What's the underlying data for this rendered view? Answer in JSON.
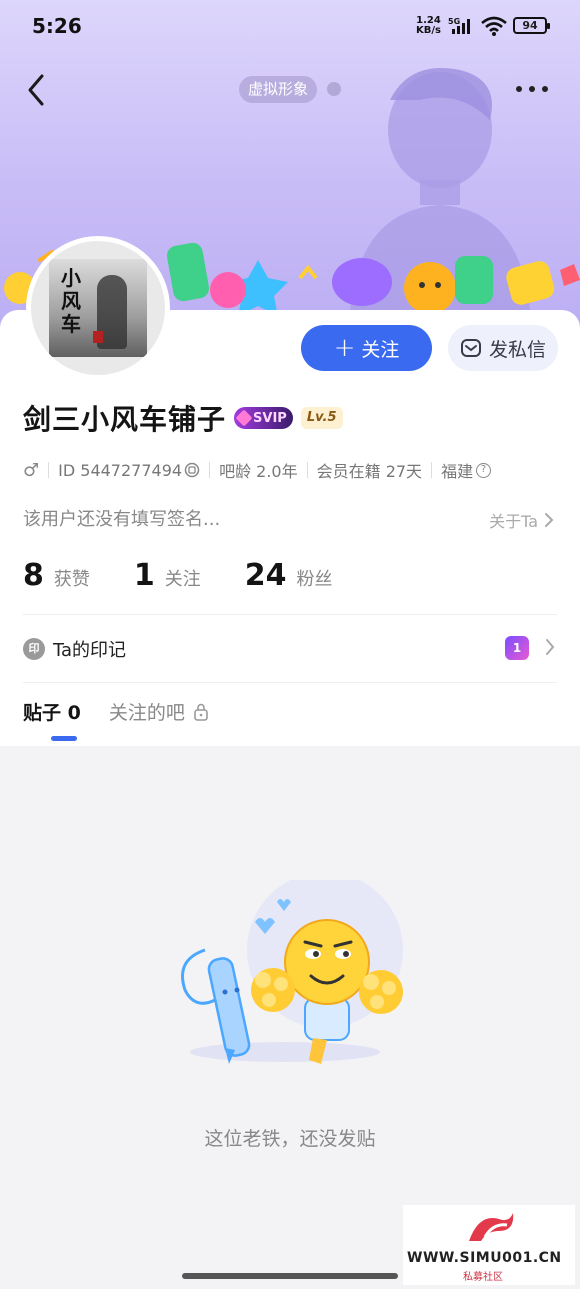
{
  "status_bar": {
    "time": "5:26",
    "net_speed_value": "1.24",
    "net_speed_unit": "KB/s",
    "network": "5G",
    "battery": "94"
  },
  "header": {
    "avatar_tag": "虚拟形象"
  },
  "profile": {
    "name": "剑三小风车铺子",
    "svip_badge": "SVIP",
    "level_badge": "Lv.5",
    "gender_icon": "♂",
    "id_text": "ID 5447277494",
    "bar_age": "吧龄 2.0年",
    "membership": "会员在籍 27天",
    "location": "福建",
    "signature": "该用户还没有填写签名...",
    "about_link": "关于Ta",
    "avatar_text": "小风车"
  },
  "actions": {
    "follow_label": "关注",
    "message_label": "发私信"
  },
  "stats": [
    {
      "value": "8",
      "label": "获赞"
    },
    {
      "value": "1",
      "label": "关注"
    },
    {
      "value": "24",
      "label": "粉丝"
    }
  ],
  "marks": {
    "icon_char": "印",
    "label": "Ta的印记",
    "medal_number": "1"
  },
  "tabs": [
    {
      "label": "贴子 0",
      "active": true
    },
    {
      "label": "关注的吧",
      "active": false
    }
  ],
  "empty_state": {
    "message": "这位老铁，还没发贴"
  },
  "watermark": {
    "url": "WWW.SIMU001.CN",
    "sub": "私募社区"
  },
  "colors": {
    "accent": "#3a6af0",
    "hero_top": "#ddd6fb",
    "hero_bottom": "#bcaef3"
  }
}
